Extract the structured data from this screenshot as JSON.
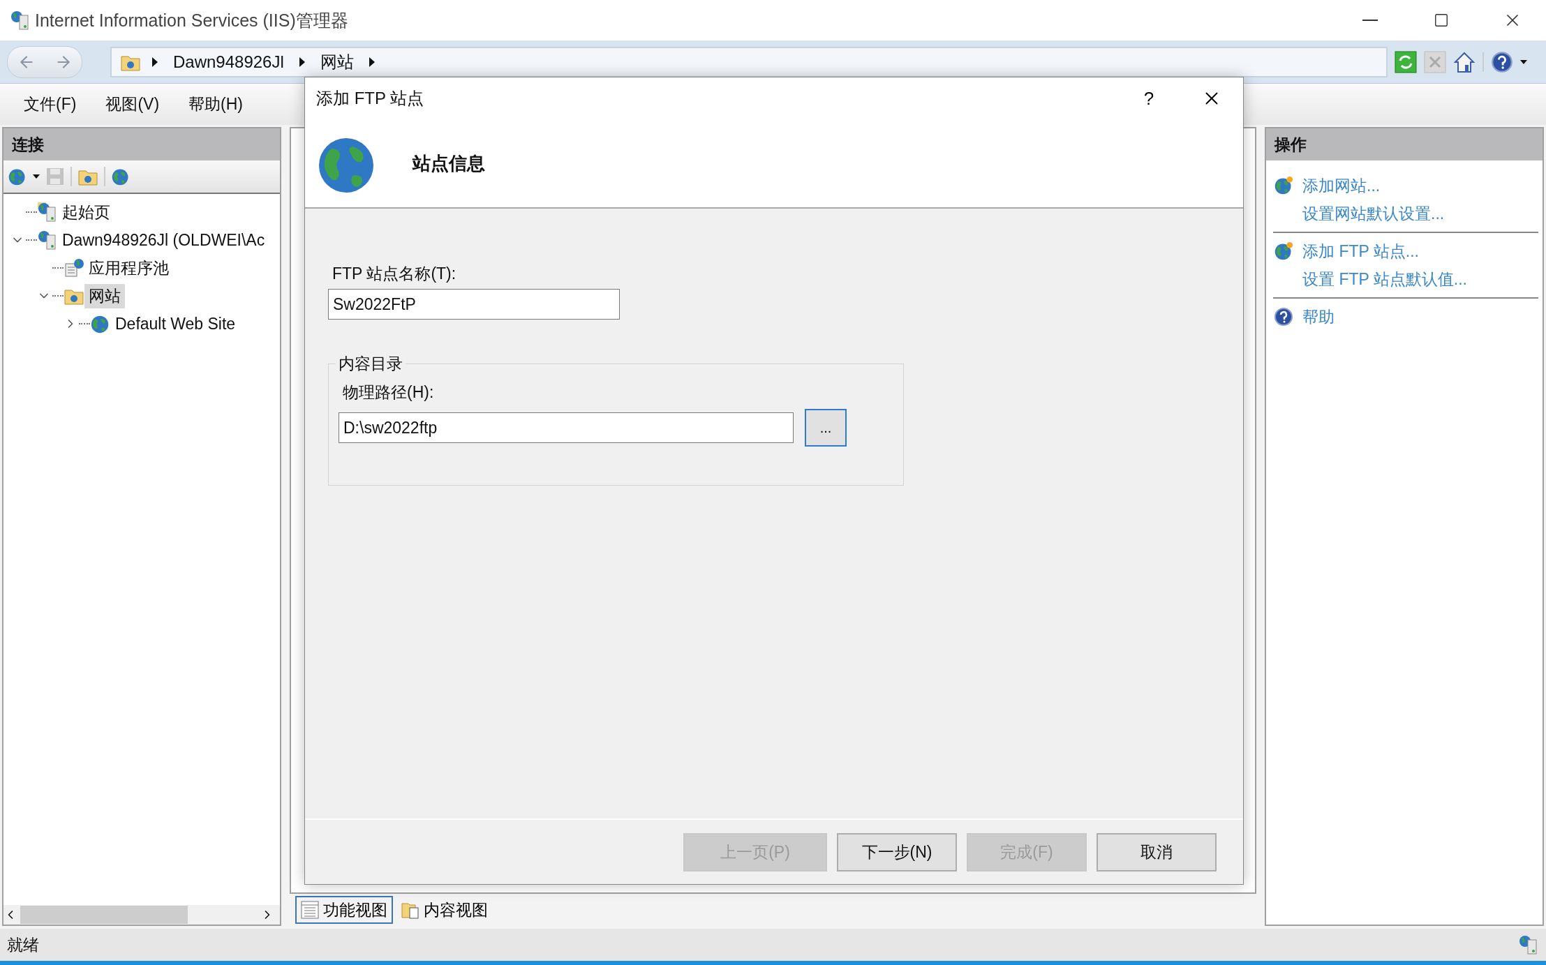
{
  "window": {
    "title": "Internet Information Services (IIS)管理器"
  },
  "address_bar": {
    "crumbs": [
      "Dawn948926Jl",
      "网站"
    ]
  },
  "menu": [
    "文件(F)",
    "视图(V)",
    "帮助(H)"
  ],
  "connections": {
    "title": "连接",
    "tree": [
      {
        "label": "起始页",
        "kind": "start",
        "selected": false
      },
      {
        "label": "Dawn948926Jl (OLDWEI\\Ac",
        "kind": "server",
        "selected": false,
        "expanded": true,
        "children": [
          {
            "label": "应用程序池",
            "kind": "pools",
            "selected": false
          },
          {
            "label": "网站",
            "kind": "sites",
            "selected": true,
            "expanded": true,
            "children": [
              {
                "label": "Default Web Site",
                "kind": "site",
                "selected": false,
                "expanded": false
              }
            ]
          }
        ]
      }
    ]
  },
  "view_tabs": [
    {
      "label": "功能视图",
      "kind": "features",
      "selected": true
    },
    {
      "label": "内容视图",
      "kind": "content",
      "selected": false
    }
  ],
  "actions": {
    "title": "操作",
    "groups": [
      {
        "items": [
          {
            "label": "添加网站...",
            "kind": "add"
          },
          {
            "label": "设置网站默认设置...",
            "kind": "plain"
          }
        ]
      },
      {
        "items": [
          {
            "label": "添加 FTP 站点...",
            "kind": "add"
          },
          {
            "label": "设置 FTP 站点默认值...",
            "kind": "plain"
          }
        ]
      },
      {
        "items": [
          {
            "label": "帮助",
            "kind": "help"
          }
        ]
      }
    ]
  },
  "status_bar": {
    "text": "就绪"
  },
  "dialog": {
    "title": "添加 FTP 站点",
    "help": "?",
    "heading": "站点信息",
    "site_name": {
      "label": "FTP 站点名称(T):",
      "value": "Sw2022FtP"
    },
    "content_dir": {
      "legend": "内容目录",
      "path_label": "物理路径(H):",
      "path_value": "D:\\sw2022ftp",
      "browse": "..."
    },
    "buttons": [
      {
        "label": "上一页(P)",
        "disabled": true
      },
      {
        "label": "下一步(N)",
        "disabled": false
      },
      {
        "label": "完成(F)",
        "disabled": true
      },
      {
        "label": "取消",
        "disabled": false
      }
    ]
  }
}
